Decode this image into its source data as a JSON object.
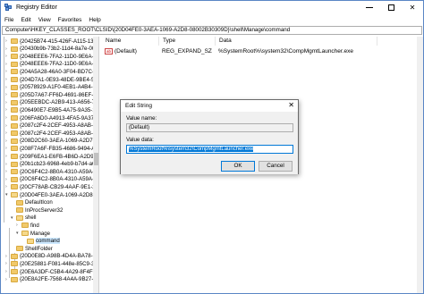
{
  "window": {
    "title": "Registry Editor",
    "controls": {
      "minimize": "—",
      "maximize": "",
      "close": "✕"
    }
  },
  "menu": [
    "File",
    "Edit",
    "View",
    "Favorites",
    "Help"
  ],
  "address": "Computer\\HKEY_CLASSES_ROOT\\CLSID\\{20D04FE0-3AEA-1069-A2D8-08002B30309D}\\shell\\Manage\\command",
  "tree": {
    "items": [
      {
        "label": "{20425B74-415-426F-A115-138BE",
        "level": 0,
        "state": "closed"
      },
      {
        "label": "{20430b9b-73b2-11d4-8a7e-00",
        "level": 0,
        "state": "closed"
      },
      {
        "label": "{2048EEE6-7FA2-11D0-9E6A-00",
        "level": 0,
        "state": "closed"
      },
      {
        "label": "{2048EEE6-7FA2-11D0-9E6A-00",
        "level": 0,
        "state": "closed"
      },
      {
        "label": "{204A5A28-46A0-3F04-BD7C-B6",
        "level": 0,
        "state": "closed"
      },
      {
        "label": "{204D7A1-0E93-48DE-9BE4-53",
        "level": 0,
        "state": "closed"
      },
      {
        "label": "{20578929-A1F0-4EB1-A4B4-6620",
        "level": 0,
        "state": "closed"
      },
      {
        "label": "{205D7A67-FF6D-4691-86EF-F3075",
        "level": 0,
        "state": "closed"
      },
      {
        "label": "{205EEBDC-A2B9-413-A656-7275",
        "level": 0,
        "state": "closed"
      },
      {
        "label": "{206490E7-E9B5-4A75-9A35-1D",
        "level": 0,
        "state": "closed"
      },
      {
        "label": "{206FA6D0-A4913-4FA5-9A37-D",
        "level": 0,
        "state": "closed"
      },
      {
        "label": "{2087c2F4-2CEF-4953-A8AB-6",
        "level": 0,
        "state": "closed"
      },
      {
        "label": "{2087c2F4-2CEF-4953-A8AB-6",
        "level": 0,
        "state": "closed"
      },
      {
        "label": "{208D2C60-3AEA-1069-A2D7-0800",
        "level": 0,
        "state": "closed"
      },
      {
        "label": "{208F7A6F-FB35-4686-9494-A62",
        "level": 0,
        "state": "closed"
      },
      {
        "label": "{209F6EA1-E6FB-4B6D-A2D9-6",
        "level": 0,
        "state": "closed"
      },
      {
        "label": "{20b1cb23-6968-4eb9-b7d4-a66d",
        "level": 0,
        "state": "closed"
      },
      {
        "label": "{20C6F4C2-8B0A-4310-A59A-5",
        "level": 0,
        "state": "closed"
      },
      {
        "label": "{20C6F4C2-8B0A-4310-A59A-5",
        "level": 0,
        "state": "closed"
      },
      {
        "label": "{20CF78AB-CB29-4AAF-9E1-29F",
        "level": 0,
        "state": "closed"
      },
      {
        "label": "{20D04FE0-3AEA-1069-A2D8-08",
        "level": 0,
        "state": "open"
      },
      {
        "label": "DefaultIcon",
        "level": 1,
        "state": "leaf"
      },
      {
        "label": "InProcServer32",
        "level": 1,
        "state": "leaf"
      },
      {
        "label": "shell",
        "level": 1,
        "state": "open"
      },
      {
        "label": "find",
        "level": 2,
        "state": "closed"
      },
      {
        "label": "Manage",
        "level": 2,
        "state": "open"
      },
      {
        "label": "command",
        "level": 3,
        "state": "selected"
      },
      {
        "label": "ShellFolder",
        "level": 1,
        "state": "leaf"
      },
      {
        "label": "{20D0E8D-A98B-4D4A-BA78-612",
        "level": 0,
        "state": "closed"
      },
      {
        "label": "{20E25881-F081-448e-85C9-3E4",
        "level": 0,
        "state": "closed"
      },
      {
        "label": "{20E6A3DF-C5B4-4A29-8F4F-31",
        "level": 0,
        "state": "closed"
      },
      {
        "label": "{20E8A2FE-7568-4A4A-9B27-0C",
        "level": 0,
        "state": "closed"
      }
    ]
  },
  "list": {
    "columns": [
      "Name",
      "Type",
      "Data"
    ],
    "rows": [
      {
        "name": "(Default)",
        "type": "REG_EXPAND_SZ",
        "data": "%SystemRoot%\\system32\\CompMgmtLauncher.exe"
      }
    ]
  },
  "dialog": {
    "title": "Edit String",
    "close": "✕",
    "value_name_label": "Value name:",
    "value_name": "(Default)",
    "value_data_label": "Value data:",
    "value_data": "%SystemRoot%\\system32\\CompMgmtLauncher.exe",
    "ok": "OK",
    "cancel": "Cancel"
  }
}
